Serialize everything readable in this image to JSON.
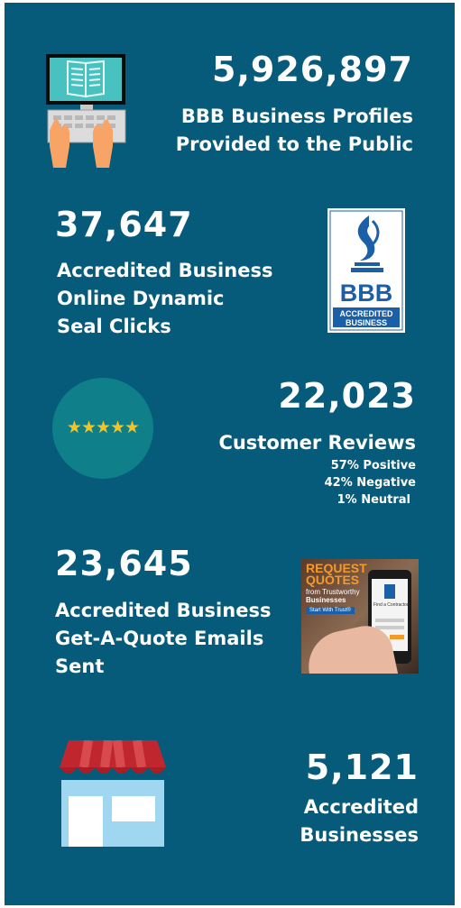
{
  "stats": [
    {
      "number": "5,926,897",
      "label_lines": [
        "BBB Business Profiles",
        "Provided to the Public"
      ]
    },
    {
      "number": "37,647",
      "label_lines": [
        "Accredited Business",
        "Online Dynamic",
        "Seal Clicks"
      ]
    },
    {
      "number": "22,023",
      "label_lines": [
        "Customer Reviews"
      ],
      "breakdown": [
        "57% Positive",
        "42% Negative",
        "1% Neutral"
      ]
    },
    {
      "number": "23,645",
      "label_lines": [
        "Accredited Business",
        "Get-A-Quote Emails",
        "Sent"
      ]
    },
    {
      "number": "5,121",
      "label_lines": [
        "Accredited",
        "Businesses"
      ]
    }
  ],
  "bbb_seal": {
    "logo_text": "BBB",
    "badge_lines": [
      "ACCREDITED",
      "BUSINESS"
    ]
  },
  "quote_ad": {
    "headline_lines": [
      "REQUEST",
      "QUOTES"
    ],
    "sub_lines": [
      "from Trustworthy",
      "Businesses"
    ],
    "tag": "Start With Trust®",
    "phone_caption": "Find a Contractor"
  },
  "stars": "★★★★★",
  "colors": {
    "panel": "#075b7a",
    "circle": "#0f8089",
    "star": "#f6c324",
    "awning_red": "#c0262e",
    "shop_blue": "#9fd7f1"
  },
  "icons": [
    "computer-reading-icon",
    "bbb-seal-icon",
    "five-star-rating-icon",
    "request-quotes-image",
    "storefront-icon"
  ]
}
